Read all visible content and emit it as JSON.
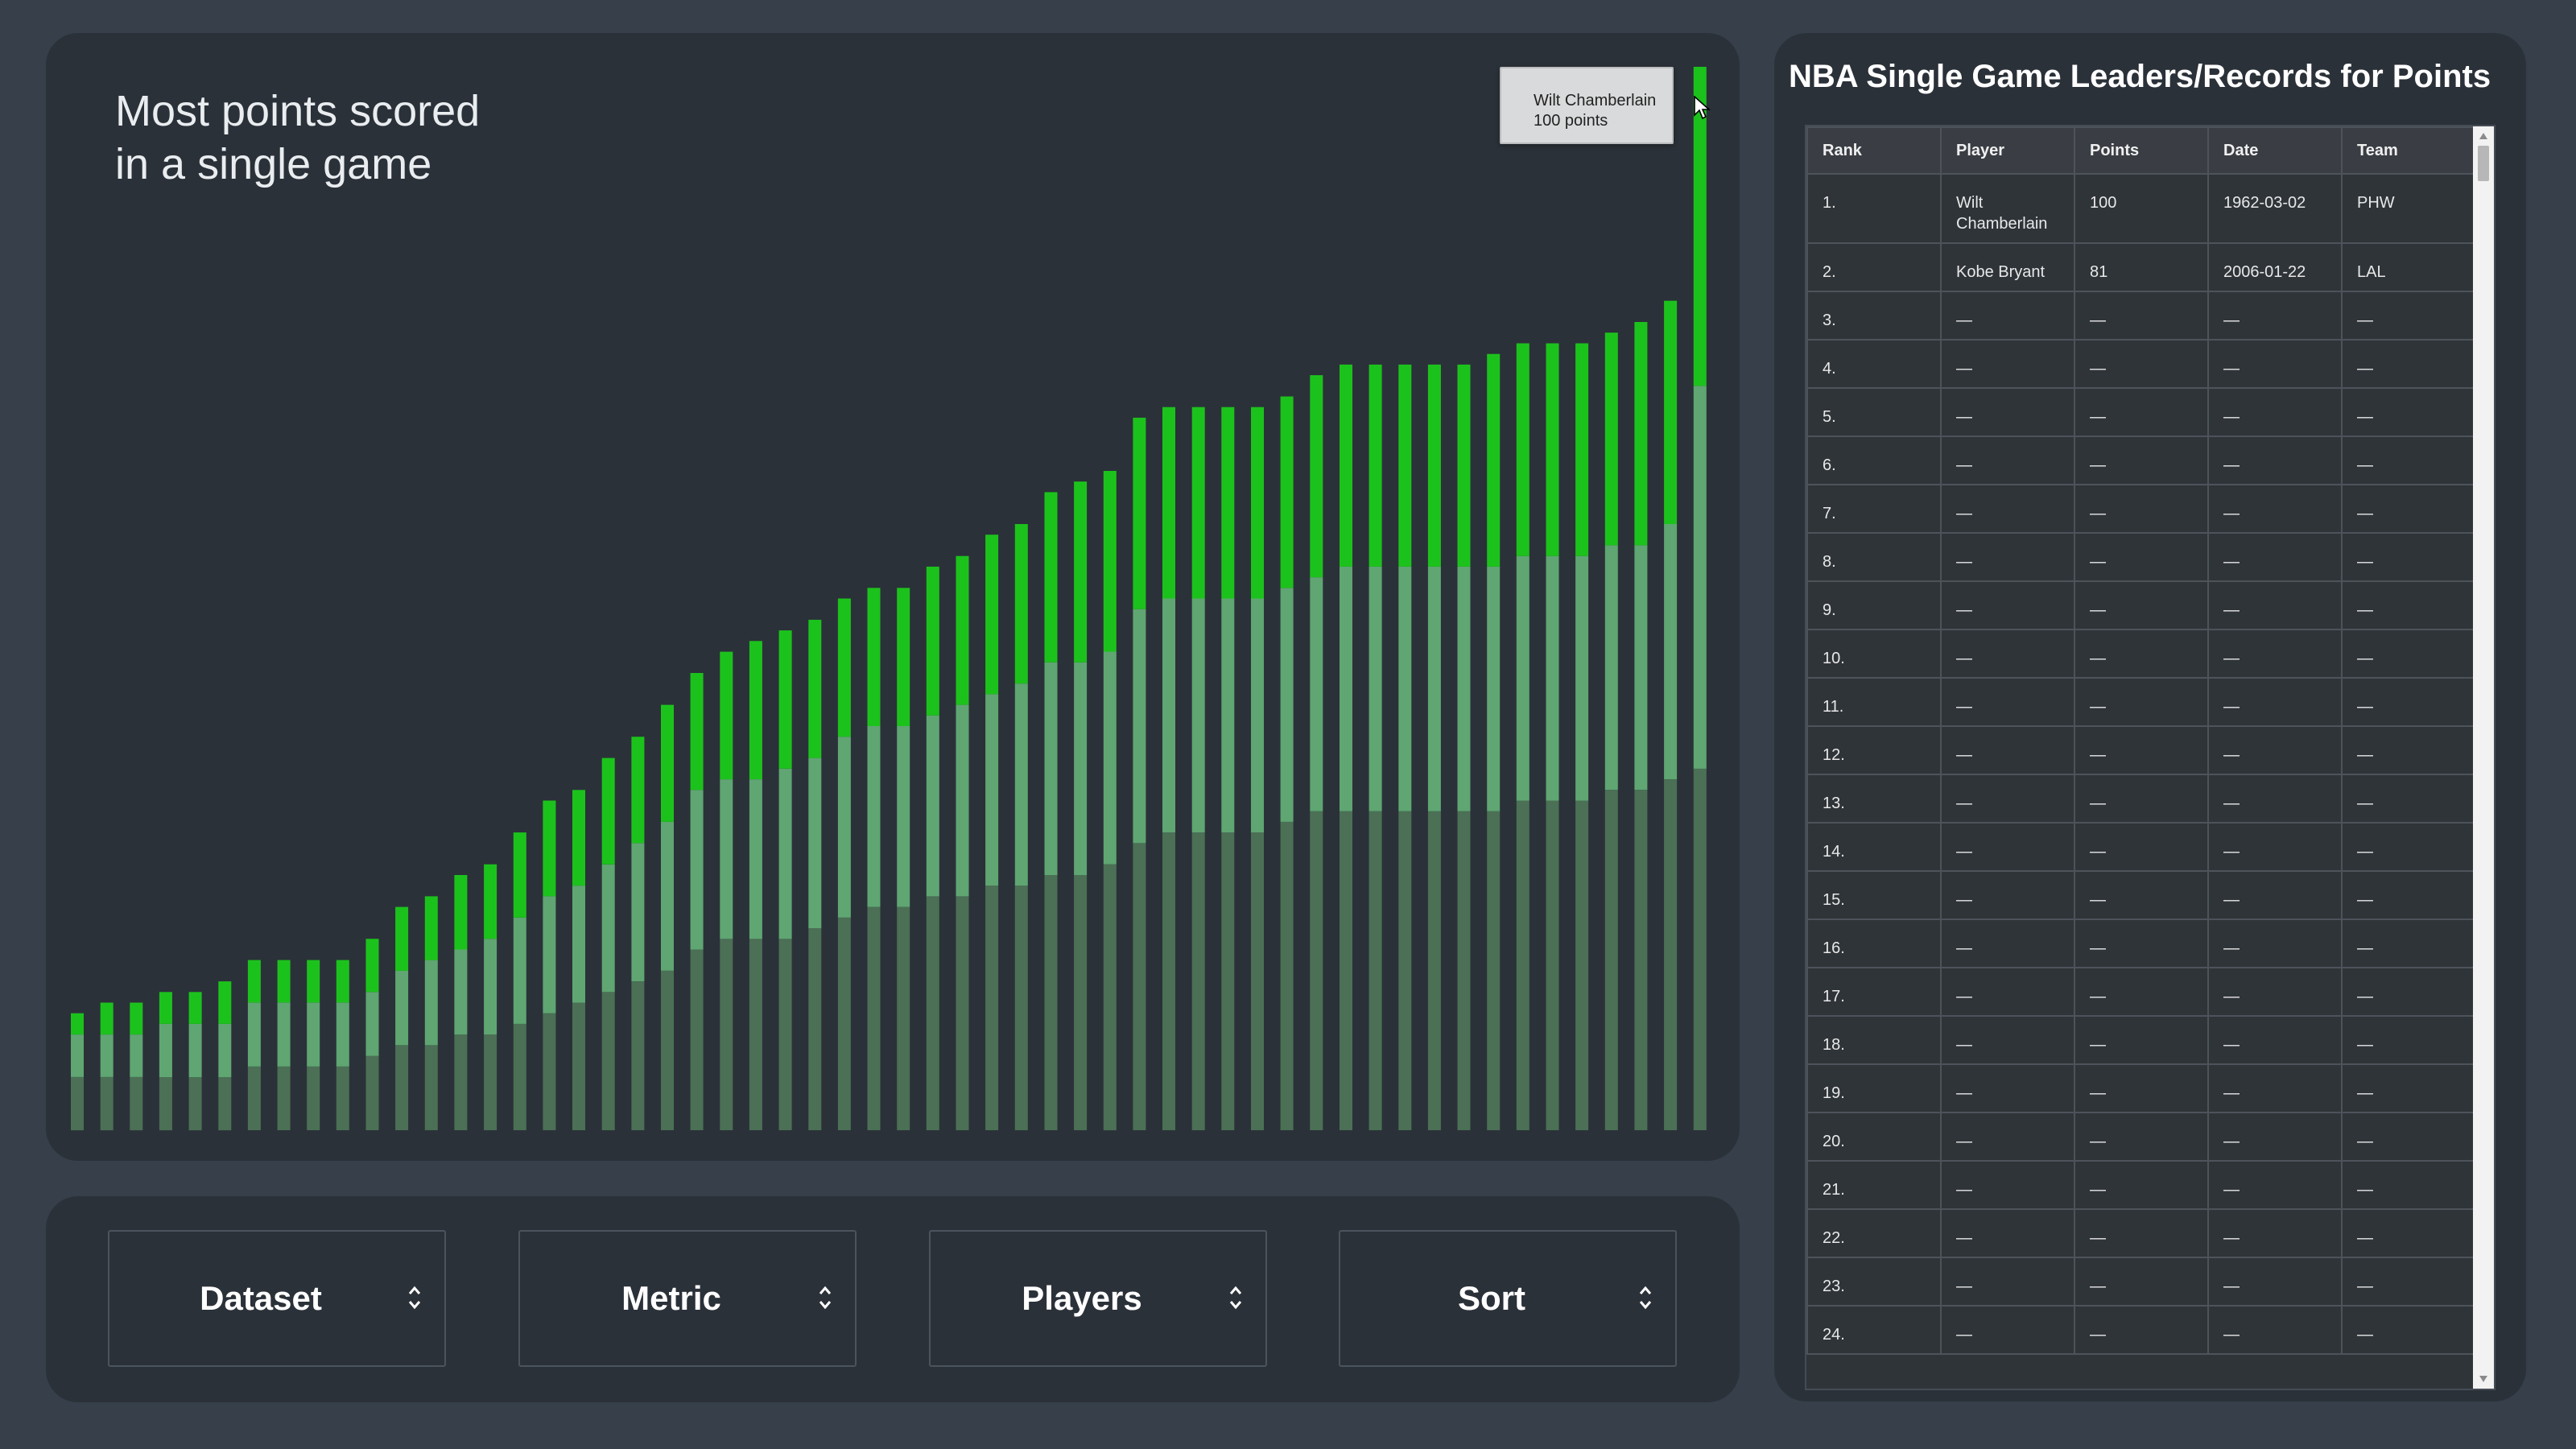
{
  "chart": {
    "title_line1": "Most points scored",
    "title_line2": "in a single game",
    "tooltip": {
      "player": "Wilt Chamberlain",
      "points_text": "100 points"
    }
  },
  "controls": [
    {
      "label": "Dataset"
    },
    {
      "label": "Metric"
    },
    {
      "label": "Players"
    },
    {
      "label": "Sort"
    }
  ],
  "table": {
    "title": "NBA Single Game Leaders/Records for Points",
    "columns": [
      "Rank",
      "Player",
      "Points",
      "Date",
      "Team"
    ],
    "rows": [
      [
        "1.",
        "Wilt Chamberlain",
        "100",
        "1962-03-02",
        "PHW"
      ],
      [
        "2.",
        "Kobe Bryant",
        "81",
        "2006-01-22",
        "LAL"
      ],
      [
        "3.",
        "—",
        "—",
        "—",
        "—"
      ],
      [
        "4.",
        "—",
        "—",
        "—",
        "—"
      ],
      [
        "5.",
        "—",
        "—",
        "—",
        "—"
      ],
      [
        "6.",
        "—",
        "—",
        "—",
        "—"
      ],
      [
        "7.",
        "—",
        "—",
        "—",
        "—"
      ],
      [
        "8.",
        "—",
        "—",
        "—",
        "—"
      ],
      [
        "9.",
        "—",
        "—",
        "—",
        "—"
      ],
      [
        "10.",
        "—",
        "—",
        "—",
        "—"
      ],
      [
        "11.",
        "—",
        "—",
        "—",
        "—"
      ],
      [
        "12.",
        "—",
        "—",
        "—",
        "—"
      ],
      [
        "13.",
        "—",
        "—",
        "—",
        "—"
      ],
      [
        "14.",
        "—",
        "—",
        "—",
        "—"
      ],
      [
        "15.",
        "—",
        "—",
        "—",
        "—"
      ],
      [
        "16.",
        "—",
        "—",
        "—",
        "—"
      ],
      [
        "17.",
        "—",
        "—",
        "—",
        "—"
      ],
      [
        "18.",
        "—",
        "—",
        "—",
        "—"
      ],
      [
        "19.",
        "—",
        "—",
        "—",
        "—"
      ],
      [
        "20.",
        "—",
        "—",
        "—",
        "—"
      ],
      [
        "21.",
        "—",
        "—",
        "—",
        "—"
      ],
      [
        "22.",
        "—",
        "—",
        "—",
        "—"
      ],
      [
        "23.",
        "—",
        "—",
        "—",
        "—"
      ],
      [
        "24.",
        "—",
        "—",
        "—",
        "—"
      ]
    ]
  },
  "colors": {
    "page_bg": "#363f4a",
    "panel_bg": "#2b3139",
    "bar_top": "#1cc21c",
    "bar_mid": "#5fa672",
    "bar_base": "#4b7055"
  },
  "icons": [
    "chevron-up-down-icon",
    "mouse-pointer-icon"
  ],
  "chart_data": {
    "type": "bar",
    "stacked": true,
    "title": "Most points scored in a single game",
    "ylim": [
      0,
      100
    ],
    "grid": false,
    "legend": "none",
    "highlight": {
      "player": "Wilt Chamberlain",
      "value": 100
    },
    "series": [
      {
        "values": [
          5,
          5,
          5,
          5,
          5,
          5,
          6,
          6,
          6,
          6,
          7,
          8,
          8,
          9,
          9,
          10,
          11,
          12,
          13,
          14,
          15,
          17,
          18,
          18,
          18,
          19,
          20,
          21,
          21,
          22,
          22,
          23,
          23,
          24,
          24,
          25,
          27,
          28,
          28,
          28,
          28,
          29,
          30,
          30,
          30,
          30,
          30,
          30,
          30,
          31,
          31,
          31,
          32,
          32,
          33,
          34
        ]
      },
      {
        "values": [
          4,
          4,
          4,
          5,
          5,
          5,
          6,
          6,
          6,
          6,
          6,
          7,
          8,
          8,
          9,
          10,
          11,
          11,
          12,
          13,
          14,
          15,
          15,
          15,
          16,
          16,
          17,
          17,
          17,
          17,
          18,
          18,
          19,
          20,
          20,
          20,
          22,
          22,
          22,
          22,
          22,
          22,
          22,
          23,
          23,
          23,
          23,
          23,
          23,
          23,
          23,
          23,
          23,
          23,
          24,
          36
        ]
      },
      {
        "values": [
          2,
          3,
          3,
          3,
          3,
          4,
          4,
          4,
          4,
          4,
          5,
          6,
          6,
          7,
          7,
          8,
          9,
          9,
          10,
          10,
          11,
          11,
          12,
          13,
          13,
          13,
          13,
          13,
          13,
          14,
          14,
          15,
          15,
          16,
          17,
          17,
          18,
          18,
          18,
          18,
          18,
          18,
          19,
          19,
          19,
          19,
          19,
          19,
          20,
          20,
          20,
          20,
          20,
          21,
          21,
          30
        ]
      }
    ]
  }
}
